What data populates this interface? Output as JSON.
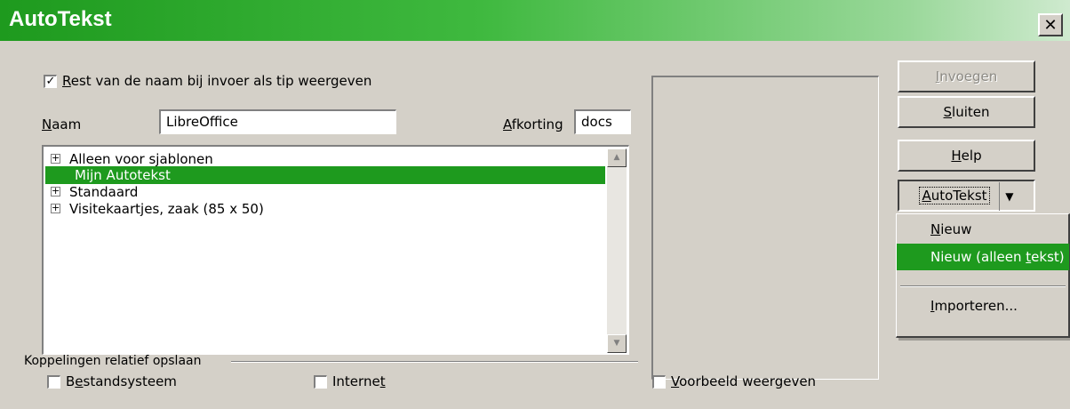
{
  "window": {
    "title": "AutoTekst",
    "close_glyph": "✕"
  },
  "tip_checkbox": {
    "label_pre": "",
    "label_u": "R",
    "label_post": "est van de naam bij invoer als tip weergeven",
    "checked": true,
    "check_glyph": "✓"
  },
  "name_field": {
    "label_u": "N",
    "label_post": "aam",
    "value": "LibreOffice"
  },
  "shortcut_field": {
    "label_u": "A",
    "label_post": "fkorting",
    "value": "docs"
  },
  "categories": [
    {
      "label": "Alleen voor sjablonen",
      "expandable": true,
      "selected": false
    },
    {
      "label": "Mijn Autotekst",
      "expandable": false,
      "selected": true
    },
    {
      "label": "Standaard",
      "expandable": true,
      "selected": false
    },
    {
      "label": "Visitekaartjes, zaak (85 x 50)",
      "expandable": true,
      "selected": false
    }
  ],
  "links_group": {
    "title": "Koppelingen relatief opslaan",
    "filesystem": {
      "pre": "B",
      "u": "e",
      "post": "standsysteem",
      "checked": false
    },
    "internet": {
      "pre": "Interne",
      "u": "t",
      "post": "",
      "checked": false
    }
  },
  "preview_checkbox": {
    "u": "V",
    "post": "oorbeeld weergeven",
    "checked": false
  },
  "buttons": {
    "insert": {
      "u": "I",
      "post": "nvoegen",
      "disabled": true
    },
    "close": {
      "u": "S",
      "post": "luiten"
    },
    "help": {
      "u": "H",
      "post": "elp"
    },
    "autotext": {
      "u": "A",
      "post": "utoTekst",
      "arrow": "▼"
    }
  },
  "menu": {
    "items": [
      {
        "pre": "",
        "u": "N",
        "post": "ieuw"
      },
      {
        "pre": "Nieuw  (alleen ",
        "u": "t",
        "post": "ekst)"
      },
      {
        "pre": "",
        "u": "I",
        "post": "mporteren..."
      }
    ],
    "highlighted_index": 1
  },
  "colors": {
    "accent": "#1e9a1e"
  }
}
